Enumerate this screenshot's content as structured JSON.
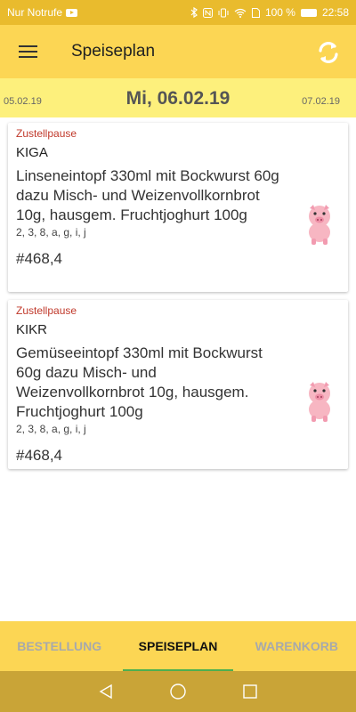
{
  "status_bar": {
    "carrier": "Nur Notrufe",
    "battery": "100 %",
    "time": "22:58"
  },
  "app_bar": {
    "title": "Speiseplan",
    "menu_icon": "hamburger-menu-icon",
    "sync_icon": "sync-icon"
  },
  "date_bar": {
    "previous": "05.02.19",
    "current": "Mi, 06.02.19",
    "next": "07.02.19"
  },
  "menu_items": [
    {
      "note": "Zustellpause",
      "group": "KIGA",
      "meal": "Linseneintopf 330ml mit Bockwurst 60g dazu Misch- und Weizenvollkornbrot 10g, hausgem. Fruchtjoghurt 100g",
      "allergens": "2, 3, 8, a, g, i, j",
      "price": "#468,4",
      "icon": "pig-icon"
    },
    {
      "note": "Zustellpause",
      "group": "KIKR",
      "meal": "Gemüseeintopf 330ml mit Bockwurst 60g dazu Misch- und Weizenvollkornbrot 10g, hausgem. Fruchtjoghurt 100g",
      "allergens": "2, 3, 8, a, g, i, j",
      "price": "#468,4",
      "icon": "pig-icon"
    }
  ],
  "bottom_nav": {
    "tabs": [
      {
        "label": "BESTELLUNG",
        "active": false
      },
      {
        "label": "SPEISEPLAN",
        "active": true
      },
      {
        "label": "WARENKORB",
        "active": false
      }
    ]
  },
  "colors": {
    "status_bar": "#e9bb2d",
    "app_bar": "#fcd654",
    "date_bar": "#fdf07c",
    "note_text": "#c0392b",
    "active_tab_indicator": "#4caf50",
    "system_nav": "#c9a437"
  }
}
